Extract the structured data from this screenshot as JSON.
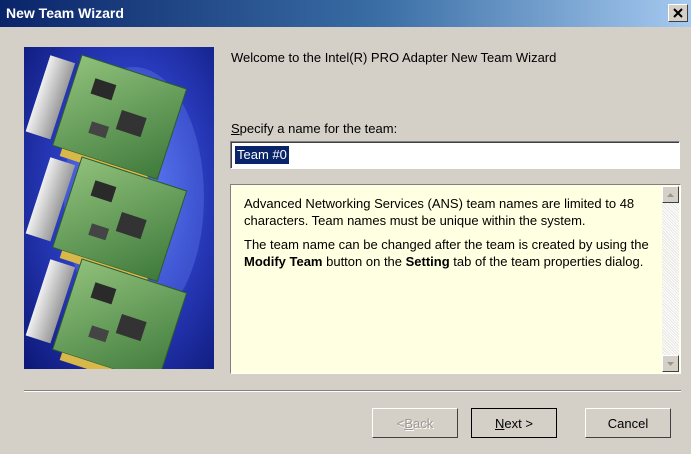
{
  "window": {
    "title": "New Team Wizard",
    "close_glyph": "×"
  },
  "wizard": {
    "welcome": "Welcome to the Intel(R) PRO Adapter New Team Wizard",
    "name_label_mnemonic": "S",
    "name_label_rest": "pecify a name for the team:",
    "team_name_value": "Team #0",
    "image_icon": "network-adapter-cards-image"
  },
  "info": {
    "para1": "Advanced Networking Services (ANS) team names are limited to 48 characters. Team names must be unique within the system.",
    "para2_a": "The team name can be changed after the team is created by using the ",
    "para2_bold1": "Modify Team",
    "para2_b": " button on the ",
    "para2_bold2": "Setting",
    "para2_c": " tab of the team properties dialog."
  },
  "buttons": {
    "back_prefix": "< ",
    "back_mnemonic": "B",
    "back_rest": "ack",
    "next_mnemonic": "N",
    "next_rest": "ext >",
    "cancel": "Cancel"
  },
  "colors": {
    "titlebar_start": "#0a246a",
    "titlebar_end": "#a6caf0",
    "dialog_bg": "#d4d0c8",
    "info_bg": "#ffffe1",
    "image_bg": "#1a2aa0"
  }
}
